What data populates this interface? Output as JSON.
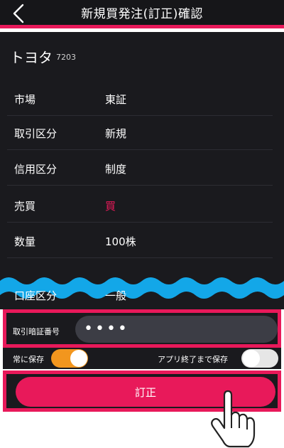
{
  "header": {
    "title": "新規買発注(訂正)確認",
    "back_icon": "chevron-left-icon"
  },
  "stock": {
    "name": "トヨタ",
    "code": "7203"
  },
  "details": [
    {
      "label": "市場",
      "value": "東証"
    },
    {
      "label": "取引区分",
      "value": "新規"
    },
    {
      "label": "信用区分",
      "value": "制度"
    },
    {
      "label": "売買",
      "value": "買"
    },
    {
      "label": "数量",
      "value": "100株"
    },
    {
      "label": "口座区分",
      "value": "一般"
    }
  ],
  "password": {
    "label": "取引暗証番号",
    "value": "••••"
  },
  "save_options": {
    "always_save_label": "常に保存",
    "always_save_on": true,
    "until_exit_label": "アプリ終了まで保存",
    "until_exit_on": false
  },
  "submit": {
    "label": "訂正"
  },
  "colors": {
    "accent": "#e8195a",
    "background": "#1a1a1e",
    "wave": "#13a7e8",
    "toggle_on": "#f2961e"
  }
}
